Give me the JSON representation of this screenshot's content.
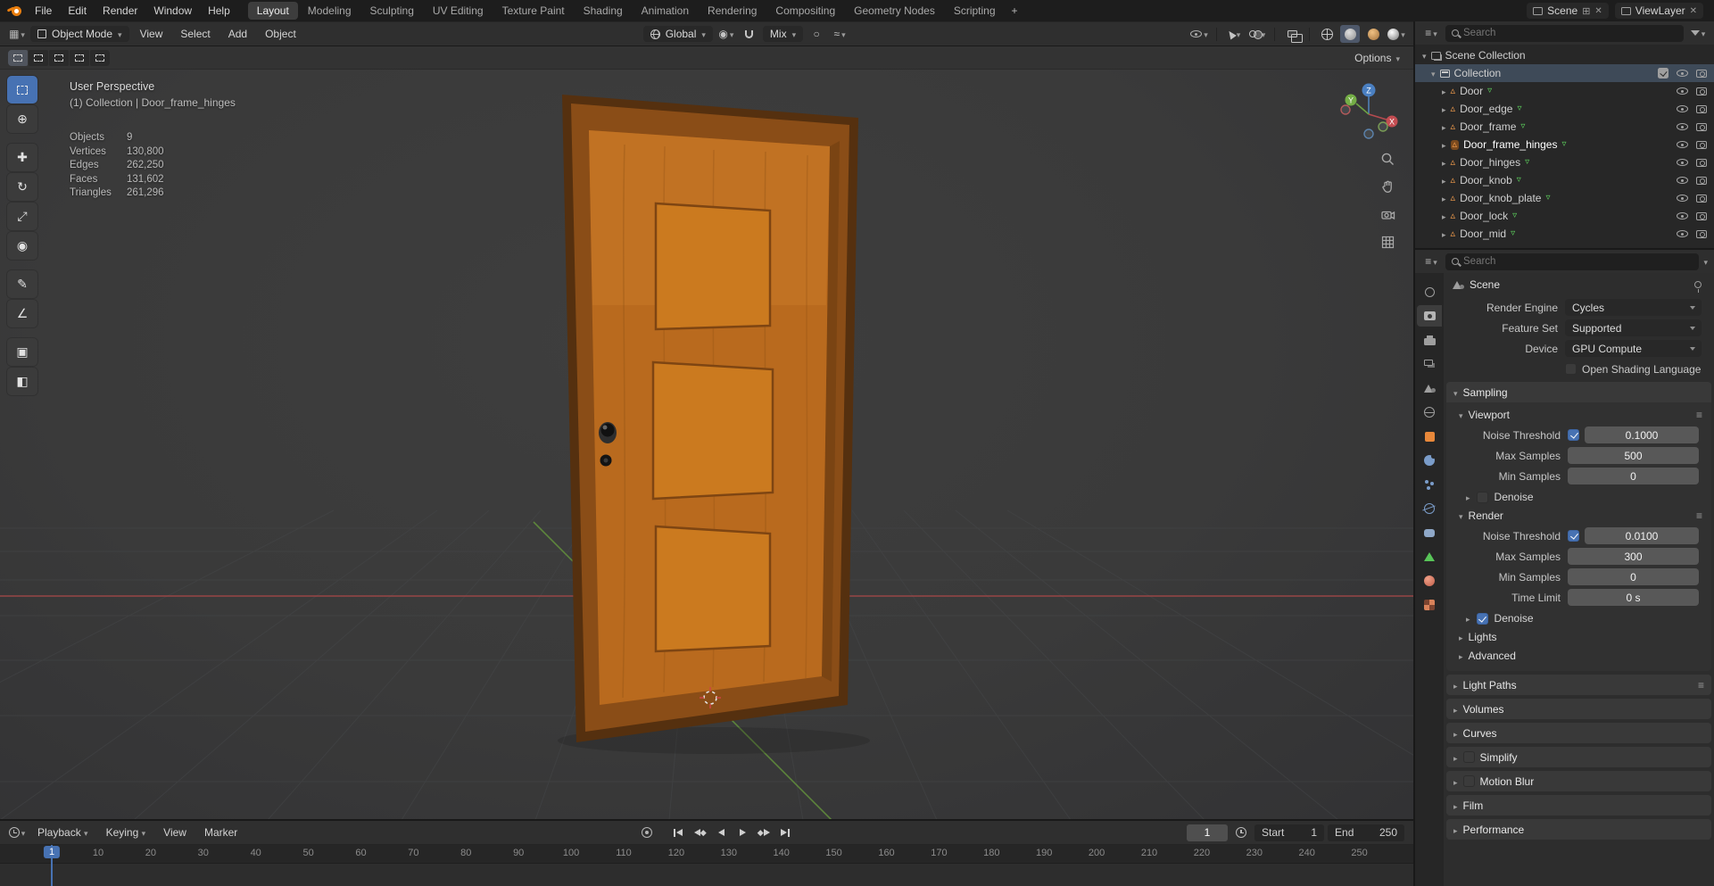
{
  "topbar": {
    "menus": [
      "File",
      "Edit",
      "Render",
      "Window",
      "Help"
    ],
    "tabs": [
      "Layout",
      "Modeling",
      "Sculpting",
      "UV Editing",
      "Texture Paint",
      "Shading",
      "Animation",
      "Rendering",
      "Compositing",
      "Geometry Nodes",
      "Scripting"
    ],
    "add_tab": "+",
    "scene": {
      "label": "Scene"
    },
    "view_layer": {
      "label": "ViewLayer"
    }
  },
  "viewport_header": {
    "mode": "Object Mode",
    "menus": [
      "View",
      "Select",
      "Add",
      "Object"
    ],
    "orientation": "Global",
    "snapping": "Mix",
    "options": "Options"
  },
  "viewport": {
    "overlay": {
      "view_name": "User Perspective",
      "context": "(1) Collection | Door_frame_hinges",
      "stats": [
        {
          "label": "Objects",
          "value": "9"
        },
        {
          "label": "Vertices",
          "value": "130,800"
        },
        {
          "label": "Edges",
          "value": "262,250"
        },
        {
          "label": "Faces",
          "value": "131,602"
        },
        {
          "label": "Triangles",
          "value": "261,296"
        }
      ]
    },
    "gizmo_axes": {
      "x": "X",
      "y": "Y",
      "z": "Z"
    }
  },
  "tools": [
    {
      "name": "select-box",
      "glyph": ""
    },
    {
      "name": "cursor",
      "glyph": "⊕"
    },
    {
      "name": "move",
      "glyph": "✚"
    },
    {
      "name": "rotate",
      "glyph": "↻"
    },
    {
      "name": "scale",
      "glyph": "⤢"
    },
    {
      "name": "transform",
      "glyph": "◉"
    },
    {
      "name": "annotate",
      "glyph": "✎"
    },
    {
      "name": "measure",
      "glyph": "∠"
    },
    {
      "name": "add-cube",
      "glyph": "▣"
    },
    {
      "name": "interactive-add",
      "glyph": "◧"
    }
  ],
  "timeline": {
    "menus": [
      "Playback",
      "Keying",
      "View",
      "Marker"
    ],
    "current_frame": "1",
    "start_label": "Start",
    "start_value": "1",
    "end_label": "End",
    "end_value": "250",
    "ticks": [
      10,
      20,
      30,
      40,
      50,
      60,
      70,
      80,
      90,
      100,
      110,
      120,
      130,
      140,
      150,
      160,
      170,
      180,
      190,
      200,
      210,
      220,
      230,
      240,
      250
    ]
  },
  "outliner": {
    "search_placeholder": "Search",
    "scene_collection": "Scene Collection",
    "collection": "Collection",
    "objects": [
      {
        "name": "Door"
      },
      {
        "name": "Door_edge"
      },
      {
        "name": "Door_frame"
      },
      {
        "name": "Door_frame_hinges",
        "active": true
      },
      {
        "name": "Door_hinges"
      },
      {
        "name": "Door_knob"
      },
      {
        "name": "Door_knob_plate"
      },
      {
        "name": "Door_lock"
      },
      {
        "name": "Door_mid"
      }
    ]
  },
  "properties": {
    "search_placeholder": "Search",
    "breadcrumb": "Scene",
    "fields": {
      "render_engine_label": "Render Engine",
      "render_engine": "Cycles",
      "feature_set_label": "Feature Set",
      "feature_set": "Supported",
      "device_label": "Device",
      "device": "GPU Compute",
      "osl": "Open Shading Language"
    },
    "sampling": {
      "title": "Sampling",
      "viewport": {
        "title": "Viewport",
        "noise_threshold_label": "Noise Threshold",
        "noise_threshold": "0.1000",
        "max_samples_label": "Max Samples",
        "max_samples": "500",
        "min_samples_label": "Min Samples",
        "min_samples": "0",
        "denoise": "Denoise"
      },
      "render": {
        "title": "Render",
        "noise_threshold_label": "Noise Threshold",
        "noise_threshold": "0.0100",
        "max_samples_label": "Max Samples",
        "max_samples": "300",
        "min_samples_label": "Min Samples",
        "min_samples": "0",
        "time_limit_label": "Time Limit",
        "time_limit": "0 s",
        "denoise": "Denoise"
      },
      "lights": "Lights",
      "advanced": "Advanced"
    },
    "panels": [
      "Light Paths",
      "Volumes",
      "Curves",
      "Simplify",
      "Motion Blur",
      "Film",
      "Performance"
    ]
  },
  "icons": {
    "caret_down": "▾",
    "caret_right": "▸",
    "preset_menu": "≡",
    "mesh_object": "▵",
    "mesh_data": "▿"
  },
  "colors": {
    "accent_blue": "#4772b3",
    "object_orange": "#e8883a",
    "data_green": "#58c558",
    "axis_red": "#a84848",
    "axis_green": "#63923c",
    "door_wood": "#b96a1e"
  }
}
